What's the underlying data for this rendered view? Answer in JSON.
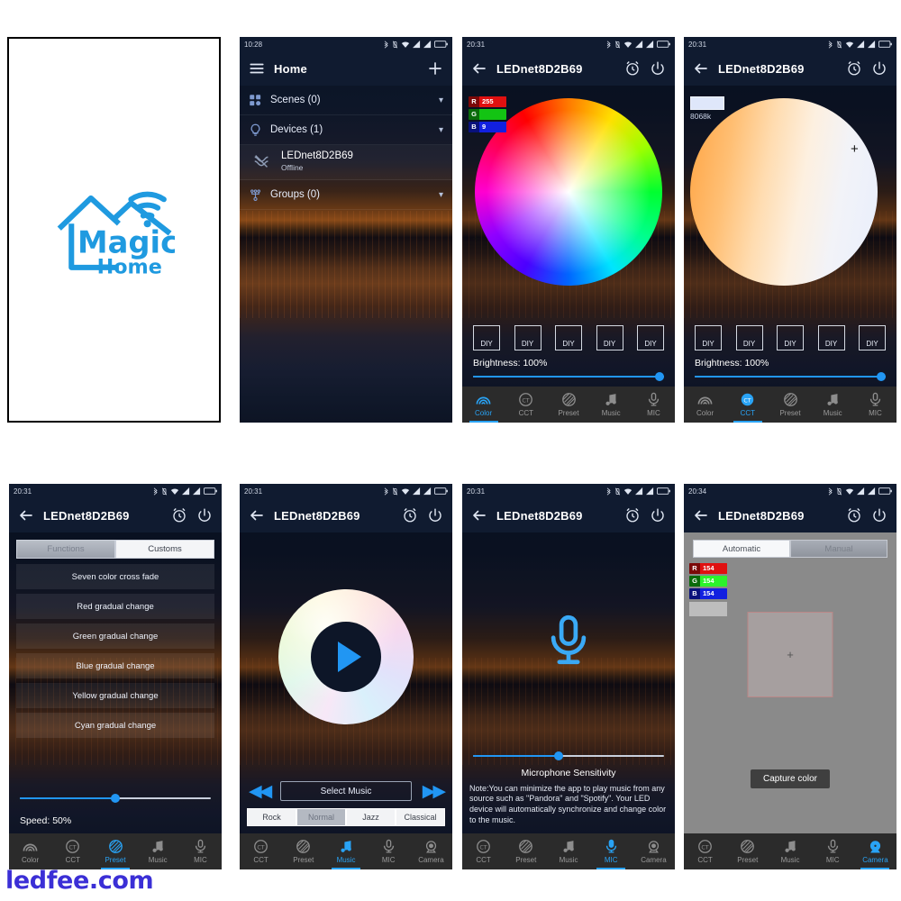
{
  "watermark": "ledfee.com",
  "app": {
    "name": "Magic Home",
    "logo_text_top": "Magic",
    "logo_text_bottom": "Home"
  },
  "status_icons": [
    "bluetooth-icon",
    "vibrate-icon",
    "wifi-icon",
    "signal-icon",
    "signal-icon",
    "battery-icon"
  ],
  "panels": [
    {
      "id": "splash",
      "name": "splash-screen",
      "logo_top": "Magic",
      "logo_bottom": "Home"
    },
    {
      "id": "home",
      "name": "home-screen",
      "status_time": "10:28",
      "title": "Home",
      "menu_icon": "hamburger-icon",
      "add_icon": "plus-icon",
      "rows": [
        {
          "label": "Scenes (0)",
          "icon": "scenes-icon",
          "chevron": "chevron-down-icon"
        },
        {
          "label": "Devices (1)",
          "icon": "bulb-icon",
          "chevron": "chevron-down-icon"
        }
      ],
      "device": {
        "name": "LEDnet8D2B69",
        "status": "Offline",
        "icon": "ledstrip-icon"
      },
      "groups_row": {
        "label": "Groups (0)",
        "icon": "group-icon",
        "chevron": "chevron-down-icon"
      }
    },
    {
      "id": "color",
      "name": "color-screen",
      "status_time": "20:31",
      "title": "LEDnet8D2B69",
      "back_icon": "back-arrow-icon",
      "timer_icon": "timer-icon",
      "power_icon": "power-icon",
      "rgb": {
        "r_key": "R",
        "r_value": "255",
        "g_key": "G",
        "g_value": "",
        "b_key": "B",
        "b_value": "9"
      },
      "diy_buttons": [
        "DIY",
        "DIY",
        "DIY",
        "DIY",
        "DIY"
      ],
      "brightness_label": "Brightness: 100%",
      "brightness_percent": 100,
      "tabs": [
        {
          "label": "Color",
          "icon": "rainbow-icon",
          "active": true
        },
        {
          "label": "CCT",
          "icon": "cct-icon",
          "active": false
        },
        {
          "label": "Preset",
          "icon": "preset-icon",
          "active": false
        },
        {
          "label": "Music",
          "icon": "music-note-icon",
          "active": false
        },
        {
          "label": "MIC",
          "icon": "microphone-icon",
          "active": false
        }
      ]
    },
    {
      "id": "cct",
      "name": "cct-screen",
      "status_time": "20:31",
      "title": "LEDnet8D2B69",
      "back_icon": "back-arrow-icon",
      "timer_icon": "timer-icon",
      "power_icon": "power-icon",
      "kelvin": "8068k",
      "diy_buttons": [
        "DIY",
        "DIY",
        "DIY",
        "DIY",
        "DIY"
      ],
      "brightness_label": "Brightness: 100%",
      "brightness_percent": 100,
      "tabs": [
        {
          "label": "Color",
          "icon": "rainbow-icon",
          "active": false
        },
        {
          "label": "CCT",
          "icon": "cct-icon",
          "active": true
        },
        {
          "label": "Preset",
          "icon": "preset-icon",
          "active": false
        },
        {
          "label": "Music",
          "icon": "music-note-icon",
          "active": false
        },
        {
          "label": "MIC",
          "icon": "microphone-icon",
          "active": false
        }
      ]
    },
    {
      "id": "preset",
      "name": "preset-screen",
      "status_time": "20:31",
      "title": "LEDnet8D2B69",
      "back_icon": "back-arrow-icon",
      "timer_icon": "timer-icon",
      "power_icon": "power-icon",
      "segments": [
        {
          "label": "Functions",
          "selected": false
        },
        {
          "label": "Customs",
          "selected": true
        }
      ],
      "items": [
        "Seven color cross fade",
        "Red gradual change",
        "Green gradual change",
        "Blue gradual change",
        "Yellow gradual change",
        "Cyan gradual change"
      ],
      "speed_label": "Speed: 50%",
      "speed_percent": 50,
      "tabs": [
        {
          "label": "Color",
          "icon": "rainbow-icon",
          "active": false
        },
        {
          "label": "CCT",
          "icon": "cct-icon",
          "active": false
        },
        {
          "label": "Preset",
          "icon": "preset-icon",
          "active": true
        },
        {
          "label": "Music",
          "icon": "music-note-icon",
          "active": false
        },
        {
          "label": "MIC",
          "icon": "microphone-icon",
          "active": false
        }
      ]
    },
    {
      "id": "music",
      "name": "music-screen",
      "status_time": "20:31",
      "title": "LEDnet8D2B69",
      "back_icon": "back-arrow-icon",
      "timer_icon": "timer-icon",
      "power_icon": "power-icon",
      "play_icon": "play-icon",
      "prev_icon": "rewind-icon",
      "next_icon": "fast-forward-icon",
      "select_music_label": "Select Music",
      "genres": [
        {
          "label": "Rock",
          "selected": false
        },
        {
          "label": "Normal",
          "selected": true
        },
        {
          "label": "Jazz",
          "selected": false
        },
        {
          "label": "Classical",
          "selected": false
        }
      ],
      "tabs": [
        {
          "label": "CCT",
          "icon": "cct-icon",
          "active": false
        },
        {
          "label": "Preset",
          "icon": "preset-icon",
          "active": false
        },
        {
          "label": "Music",
          "icon": "music-note-icon",
          "active": true
        },
        {
          "label": "MIC",
          "icon": "microphone-icon",
          "active": false
        },
        {
          "label": "Camera",
          "icon": "camera-icon",
          "active": false
        }
      ]
    },
    {
      "id": "mic",
      "name": "mic-screen",
      "status_time": "20:31",
      "title": "LEDnet8D2B69",
      "back_icon": "back-arrow-icon",
      "timer_icon": "timer-icon",
      "power_icon": "power-icon",
      "mic_icon": "microphone-icon",
      "sensitivity_percent": 45,
      "sensitivity_label": "Microphone Sensitivity",
      "note": "Note:You can minimize the app to play music from any source such as \"Pandora\" and \"Spotify\". Your LED device will automatically synchronize and change color to the music.",
      "tabs": [
        {
          "label": "CCT",
          "icon": "cct-icon",
          "active": false
        },
        {
          "label": "Preset",
          "icon": "preset-icon",
          "active": false
        },
        {
          "label": "Music",
          "icon": "music-note-icon",
          "active": false
        },
        {
          "label": "MIC",
          "icon": "microphone-icon",
          "active": true
        },
        {
          "label": "Camera",
          "icon": "camera-icon",
          "active": false
        }
      ]
    },
    {
      "id": "camera",
      "name": "camera-screen",
      "status_time": "20:34",
      "title": "LEDnet8D2B69",
      "back_icon": "back-arrow-icon",
      "timer_icon": "timer-icon",
      "power_icon": "power-icon",
      "segments": [
        {
          "label": "Automatic",
          "selected": true
        },
        {
          "label": "Manual",
          "selected": false
        }
      ],
      "rgb": {
        "r_key": "R",
        "r_value": "154",
        "g_key": "G",
        "g_value": "154",
        "b_key": "B",
        "b_value": "154"
      },
      "crosshair": "+",
      "capture_label": "Capture color",
      "tabs": [
        {
          "label": "CCT",
          "icon": "cct-icon",
          "active": false
        },
        {
          "label": "Preset",
          "icon": "preset-icon",
          "active": false
        },
        {
          "label": "Music",
          "icon": "music-note-icon",
          "active": false
        },
        {
          "label": "MIC",
          "icon": "microphone-icon",
          "active": false
        },
        {
          "label": "Camera",
          "icon": "camera-icon",
          "active": true
        }
      ]
    }
  ],
  "colors": {
    "accent": "#29a3f5",
    "appbar": "#101b30",
    "tabbar": "#2b2b2b",
    "logo": "#1f9ae0",
    "watermark": "#3b2fd6"
  }
}
